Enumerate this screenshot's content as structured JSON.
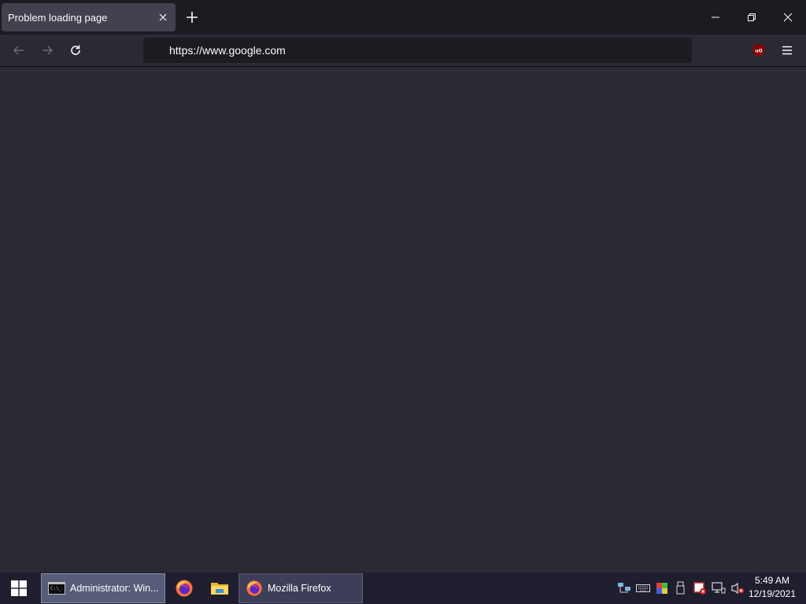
{
  "browser": {
    "tab": {
      "title": "Problem loading page"
    },
    "url": "https://www.google.com"
  },
  "taskbar": {
    "items": [
      {
        "label": "Administrator: Win..."
      },
      {
        "label": "Mozilla Firefox"
      }
    ],
    "clock": {
      "time": "5:49 AM",
      "date": "12/19/2021"
    }
  },
  "colors": {
    "tabstrip_bg": "#1c1b22",
    "active_tab_bg": "#42414d",
    "content_bg": "#2b2a33",
    "taskbar_bg": "#1f1e2e",
    "ublock_red": "#800000"
  },
  "icons": {
    "tab_close": "close-icon",
    "new_tab": "plus-icon",
    "minimize": "minimize-icon",
    "restore": "restore-icon",
    "close": "close-icon",
    "back": "back-arrow-icon",
    "forward": "forward-arrow-icon",
    "reload": "reload-icon",
    "ublock": "ublock-origin-icon",
    "menu": "hamburger-menu-icon",
    "start": "windows-logo-icon"
  }
}
